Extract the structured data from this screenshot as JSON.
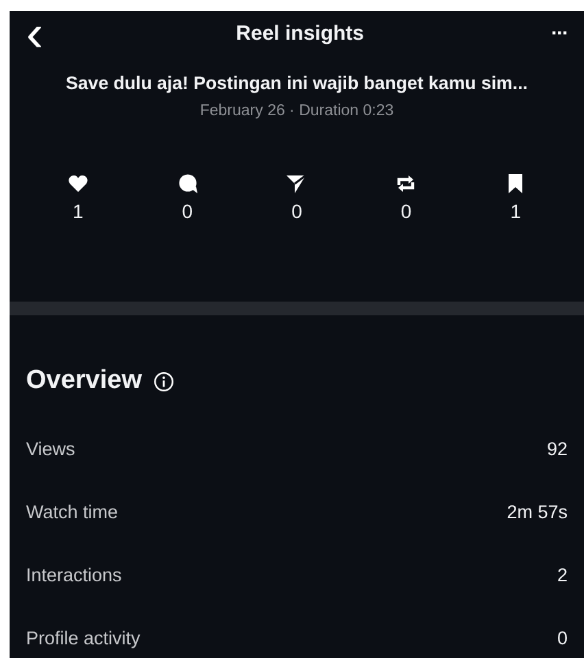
{
  "header": {
    "back": "‹",
    "title": "Reel insights",
    "more": "···"
  },
  "post": {
    "caption": "Save dulu aja! Postingan ini wajib banget kamu sim...",
    "meta": "February 26 · Duration 0:23"
  },
  "stats": [
    {
      "kind": "likes",
      "value": "1"
    },
    {
      "kind": "comments",
      "value": "0"
    },
    {
      "kind": "shares",
      "value": "0"
    },
    {
      "kind": "reposts",
      "value": "0"
    },
    {
      "kind": "saves",
      "value": "1"
    }
  ],
  "overview": {
    "title": "Overview",
    "rows": [
      {
        "label": "Views",
        "value": "92"
      },
      {
        "label": "Watch time",
        "value": "2m 57s"
      },
      {
        "label": "Interactions",
        "value": "2"
      },
      {
        "label": "Profile activity",
        "value": "0"
      }
    ]
  }
}
